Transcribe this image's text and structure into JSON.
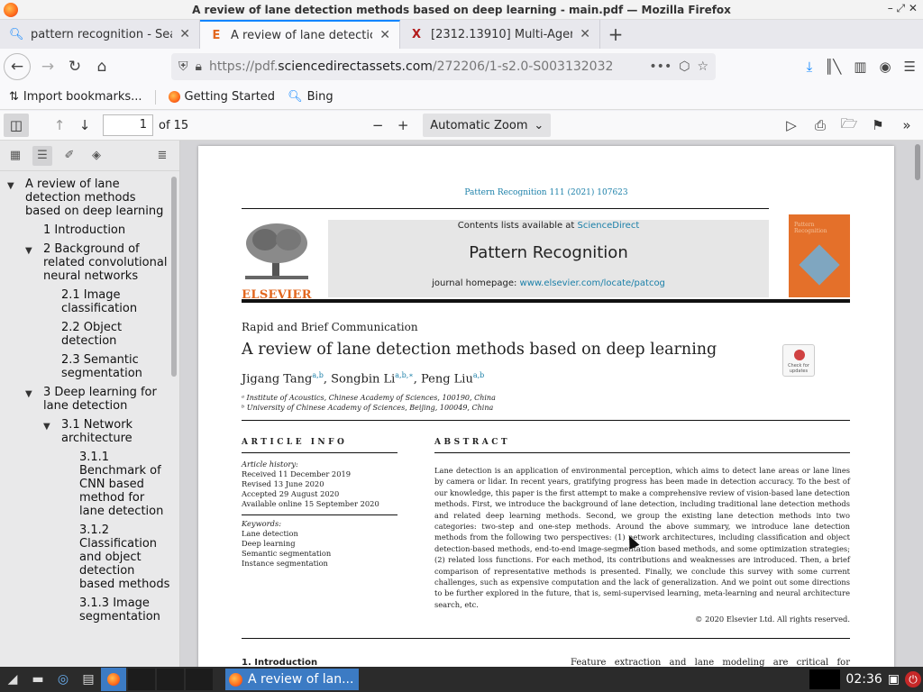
{
  "window": {
    "title": "A review of lane detection methods based on deep learning - main.pdf — Mozilla Firefox",
    "controls": "– ⤢ ✕"
  },
  "tabs": [
    {
      "label": "pattern recognition - Sea",
      "icon": "search-icon",
      "active": false
    },
    {
      "label": "A review of lane detectic",
      "icon": "elsevier-icon",
      "active": true
    },
    {
      "label": "[2312.13910] Multi-Agen",
      "icon": "arxiv-icon",
      "active": false
    }
  ],
  "url": {
    "prefix": "https://pdf.",
    "host": "sciencedirectassets.com",
    "path": "/272206/1-s2.0-S003132032"
  },
  "bookmarks": [
    {
      "label": "Import bookmarks...",
      "icon": "import-icon"
    },
    {
      "label": "Getting Started",
      "icon": "firefox-icon"
    },
    {
      "label": "Bing",
      "icon": "search-icon"
    }
  ],
  "pdf_toolbar": {
    "page": "1",
    "of_pages": "of 15",
    "zoom": "Automatic Zoom"
  },
  "outline": [
    {
      "label": "A review of lane detection methods based on deep learning",
      "level": 0,
      "twisty": "▼"
    },
    {
      "label": "1 Introduction",
      "level": 1,
      "twisty": ""
    },
    {
      "label": "2 Background of related convolutional neural networks",
      "level": 1,
      "twisty": "▼"
    },
    {
      "label": "2.1 Image classification",
      "level": 2,
      "twisty": ""
    },
    {
      "label": "2.2 Object detection",
      "level": 2,
      "twisty": ""
    },
    {
      "label": "2.3 Semantic segmentation",
      "level": 2,
      "twisty": ""
    },
    {
      "label": "3 Deep learning for lane detection",
      "level": 1,
      "twisty": "▼"
    },
    {
      "label": "3.1 Network architecture",
      "level": 2,
      "twisty": "▼"
    },
    {
      "label": "3.1.1 Benchmark of CNN based method for lane detection",
      "level": 3,
      "twisty": ""
    },
    {
      "label": "3.1.2 Classification and object detection based methods",
      "level": 3,
      "twisty": ""
    },
    {
      "label": "3.1.3 Image segmentation",
      "level": 3,
      "twisty": ""
    }
  ],
  "paper": {
    "journal_ref": "Pattern Recognition 111 (2021) 107623",
    "contents_prefix": "Contents lists available at ",
    "contents_link": "ScienceDirect",
    "journal_name": "Pattern Recognition",
    "homepage_prefix": "journal homepage: ",
    "homepage_link": "www.elsevier.com/locate/patcog",
    "publisher": "ELSEVIER",
    "check_updates": "Check for updates",
    "article_type": "Rapid and Brief Communication",
    "title": "A review of lane detection methods based on deep learning",
    "authors": [
      {
        "name": "Jigang Tang",
        "sup": "a,b"
      },
      {
        "name": "Songbin Li",
        "sup": "a,b,∗"
      },
      {
        "name": "Peng Liu",
        "sup": "a,b"
      }
    ],
    "affiliations": [
      "ᵃ Institute of Acoustics, Chinese Academy of Sciences, 100190, China",
      "ᵇ University of Chinese Academy of Sciences, Beijing, 100049, China"
    ],
    "article_info_heading": "ARTICLE INFO",
    "abstract_heading": "ABSTRACT",
    "history_label": "Article history:",
    "history": [
      "Received 11 December 2019",
      "Revised 13 June 2020",
      "Accepted 29 August 2020",
      "Available online 15 September 2020"
    ],
    "keywords_label": "Keywords:",
    "keywords": [
      "Lane detection",
      "Deep learning",
      "Semantic segmentation",
      "Instance segmentation"
    ],
    "abstract": "Lane detection is an application of environmental perception, which aims to detect lane areas or lane lines by camera or lidar. In recent years, gratifying progress has been made in detection accuracy. To the best of our knowledge, this paper is the first attempt to make a comprehensive review of vision-based lane detection methods. First, we introduce the background of lane detection, including traditional lane detection methods and related deep learning methods. Second, we group the existing lane detection methods into two categories: two-step and one-step methods. Around the above summary, we introduce lane detection methods from the following two perspectives: (1) network architectures, including classification and object detection-based methods, end-to-end image-segmentation based methods, and some optimization strategies; (2) related loss functions. For each method, its contributions and weaknesses are introduced. Then, a brief comparison of representative methods is presented. Finally, we conclude this survey with some current challenges, such as expensive computation and the lack of generalization. And we point out some directions to be further explored in the future, that is, semi-supervised learning, meta-learning and neural architecture search, etc.",
    "copyright": "© 2020 Elsevier Ltd. All rights reserved.",
    "intro_heading": "1. Introduction",
    "intro_text": "Feature extraction and lane modeling are critical for obtaining"
  },
  "taskbar": {
    "task_label": "A review of lan...",
    "clock": "02:36"
  }
}
